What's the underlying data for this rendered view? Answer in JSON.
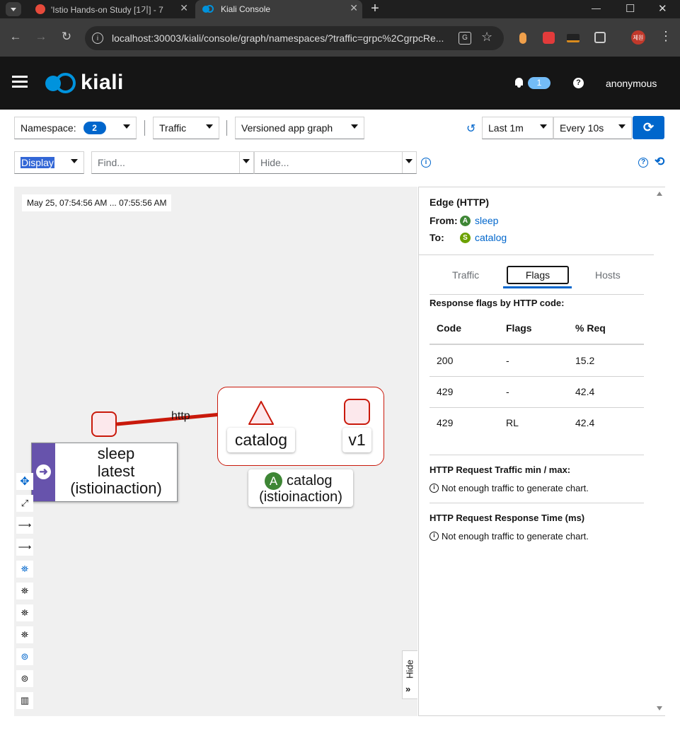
{
  "browser": {
    "tabs": [
      {
        "label": "'Istio Hands-on Study [1기] - 7",
        "active": false
      },
      {
        "label": "Kiali Console",
        "active": true
      }
    ],
    "new_tab": "+",
    "url": "localhost:30003/kiali/console/graph/namespaces/?traffic=grpc%2CgrpcRe...",
    "window_controls": [
      "—",
      "☐",
      "✕"
    ],
    "profile_badge": "제원"
  },
  "header": {
    "brand": "kiali",
    "notifications_count": "1",
    "user": "anonymous"
  },
  "controls": {
    "namespace_label": "Namespace:",
    "namespace_count": "2",
    "traffic_label": "Traffic",
    "graph_type": "Versioned app graph",
    "duration": "Last 1m",
    "refresh_interval": "Every 10s",
    "display_label": "Display",
    "find_placeholder": "Find...",
    "hide_placeholder": "Hide..."
  },
  "graph": {
    "time_range": "May 25, 07:54:56 AM ... 07:55:56 AM",
    "edge_label": "http",
    "sleep_node": {
      "line1": "sleep",
      "line2": "latest",
      "line3": "(istioinaction)"
    },
    "catalog_service_label": "catalog",
    "catalog_version_label": "v1",
    "catalog_app_badge": "A",
    "catalog_app": {
      "line1": "catalog",
      "line2": "(istioinaction)"
    },
    "hide_label": "Hide"
  },
  "panel": {
    "title": "Edge (HTTP)",
    "from_label": "From:",
    "from_badge": "A",
    "from_value": "sleep",
    "to_label": "To:",
    "to_badge": "S",
    "to_value": "catalog",
    "tabs": [
      "Traffic",
      "Flags",
      "Hosts"
    ],
    "active_tab": "Flags",
    "flags_heading": "Response flags by HTTP code:",
    "table": {
      "columns": [
        "Code",
        "Flags",
        "% Req"
      ],
      "rows": [
        [
          "200",
          "-",
          "15.2"
        ],
        [
          "429",
          "-",
          "42.4"
        ],
        [
          "429",
          "RL",
          "42.4"
        ]
      ]
    },
    "traffic_heading": "HTTP Request Traffic min / max:",
    "traffic_note": "Not enough traffic to generate chart.",
    "response_heading": "HTTP Request Response Time (ms)",
    "response_note": "Not enough traffic to generate chart."
  },
  "colors": {
    "accent_blue": "#0066cc",
    "edge_error_red": "#c9190b",
    "app_badge_green": "#3e8635",
    "service_badge_green": "#6ca100",
    "workload_purple": "#6753ac"
  }
}
